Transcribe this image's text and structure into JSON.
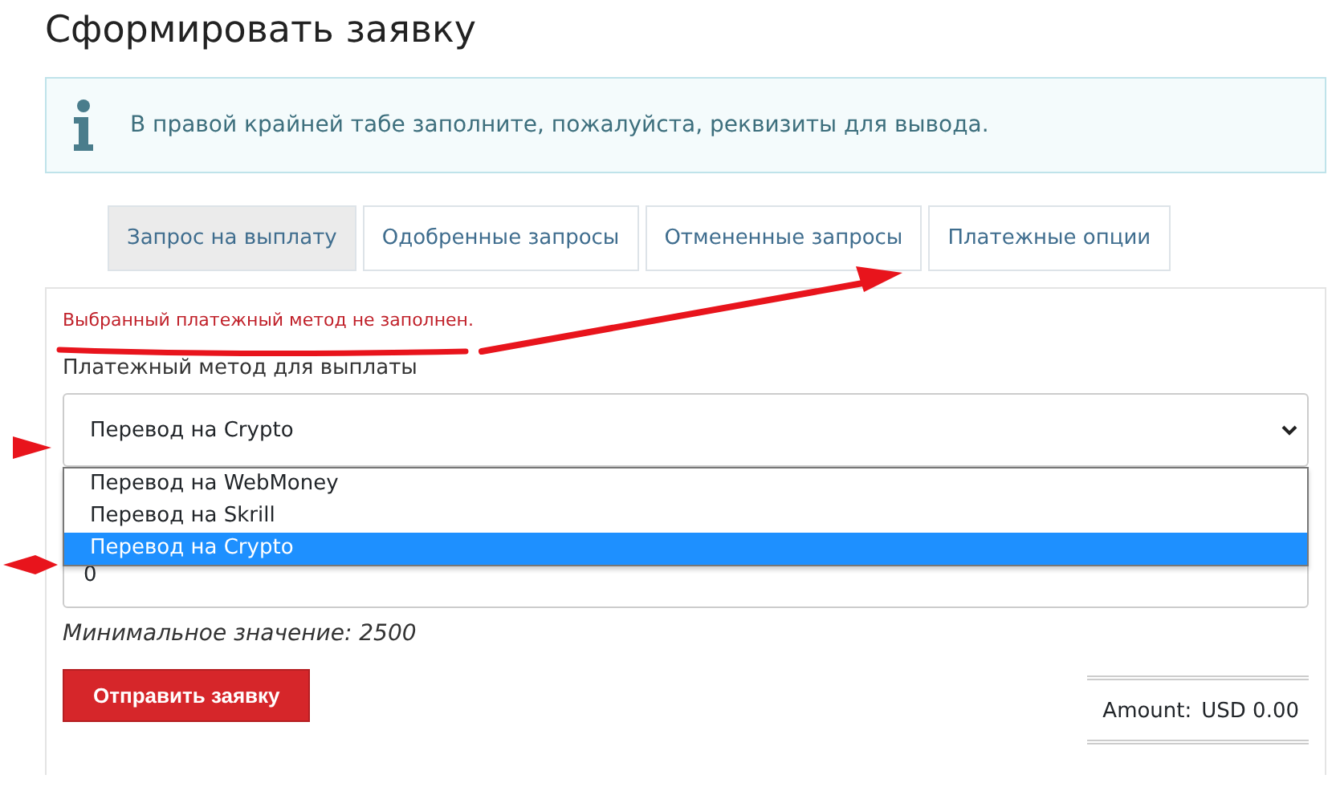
{
  "page_title": "Сформировать заявку",
  "info_alert": {
    "text": "В правой крайней табе заполните, пожалуйста, реквизиты для вывода."
  },
  "tabs": [
    {
      "label": "Запрос на выплату",
      "selected": true
    },
    {
      "label": "Одобренные запросы",
      "selected": false
    },
    {
      "label": "Отмененные запросы",
      "selected": false
    },
    {
      "label": "Платежные опции",
      "selected": false
    }
  ],
  "form": {
    "error": "Выбранный платежный метод не заполнен.",
    "method_label": "Платежный метод для выплаты",
    "method_select": {
      "value": "Перевод на Crypto",
      "expanded": true,
      "options": [
        {
          "label": "Перевод на WebMoney",
          "selected": false
        },
        {
          "label": "Перевод на Skrill",
          "selected": false
        },
        {
          "label": "Перевод на Crypto",
          "selected": true
        }
      ]
    },
    "amount_field": {
      "value": "0"
    },
    "hint": "Минимальное значение: 2500",
    "submit_button": "Отправить заявку"
  },
  "summary": {
    "label": "Amount:",
    "value": "USD 0.00"
  }
}
